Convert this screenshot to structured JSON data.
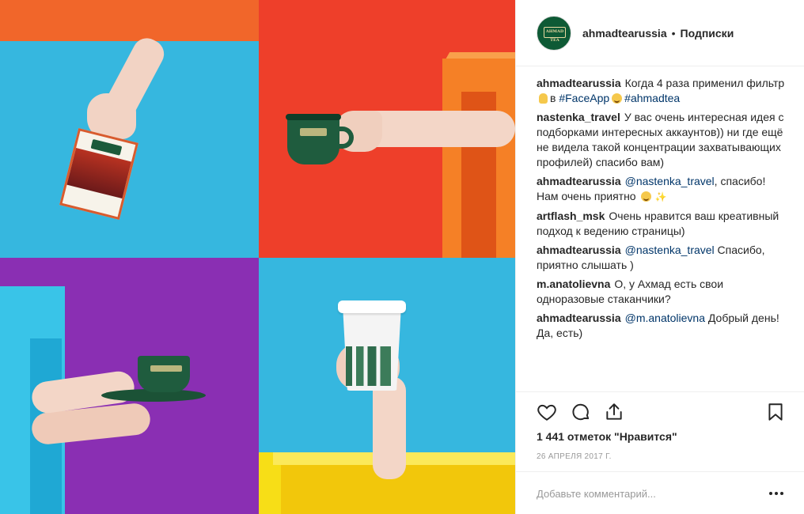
{
  "header": {
    "avatar_text": "AHMAD TEA",
    "username": "ahmadtearussia",
    "separator": "•",
    "follow_label": "Подписки"
  },
  "comments": [
    {
      "user": "ahmadtearussia",
      "parts": [
        {
          "type": "text",
          "value": "Когда 4 раза применил фильтр"
        },
        {
          "type": "emoji",
          "value": "hand"
        },
        {
          "type": "text",
          "value": "в "
        },
        {
          "type": "tag",
          "value": "#FaceApp"
        },
        {
          "type": "emoji",
          "value": "face"
        },
        {
          "type": "tag",
          "value": "#ahmadtea"
        }
      ]
    },
    {
      "user": "nastenka_travel",
      "parts": [
        {
          "type": "text",
          "value": "У вас очень интересная идея с подборками интересных аккаунтов)) ни где ещё не видела такой концентрации захватывающих профилей) спасибо вам)"
        }
      ]
    },
    {
      "user": "ahmadtearussia",
      "parts": [
        {
          "type": "tag",
          "value": "@nastenka_travel"
        },
        {
          "type": "text",
          "value": ", спасибо! Нам очень приятно "
        },
        {
          "type": "emoji",
          "value": "face"
        },
        {
          "type": "emoji",
          "value": "sparkle"
        }
      ]
    },
    {
      "user": "artflash_msk",
      "parts": [
        {
          "type": "text",
          "value": "Очень нравится ваш креативный подход к ведению страницы)"
        }
      ]
    },
    {
      "user": "ahmadtearussia",
      "parts": [
        {
          "type": "tag",
          "value": "@nastenka_travel"
        },
        {
          "type": "text",
          "value": " Спасибо, приятно слышать )"
        }
      ]
    },
    {
      "user": "m.anatolievna",
      "parts": [
        {
          "type": "text",
          "value": "О, у Ахмад есть свои одноразовые стаканчики?"
        }
      ]
    },
    {
      "user": "ahmadtearussia",
      "parts": [
        {
          "type": "tag",
          "value": "@m.anatolievna"
        },
        {
          "type": "text",
          "value": " Добрый день! Да, есть)"
        }
      ]
    }
  ],
  "actions": {
    "icons": [
      "heart-icon",
      "comment-icon",
      "share-icon",
      "bookmark-icon"
    ]
  },
  "likes_text": "1 441 отметок \"Нравится\"",
  "date_text": "26 апреля 2017 г.",
  "add_comment": {
    "placeholder": "Добавьте комментарий..."
  },
  "colors": {
    "tag": "#003569",
    "muted": "#999999",
    "brand_green": "#0e5a35"
  }
}
